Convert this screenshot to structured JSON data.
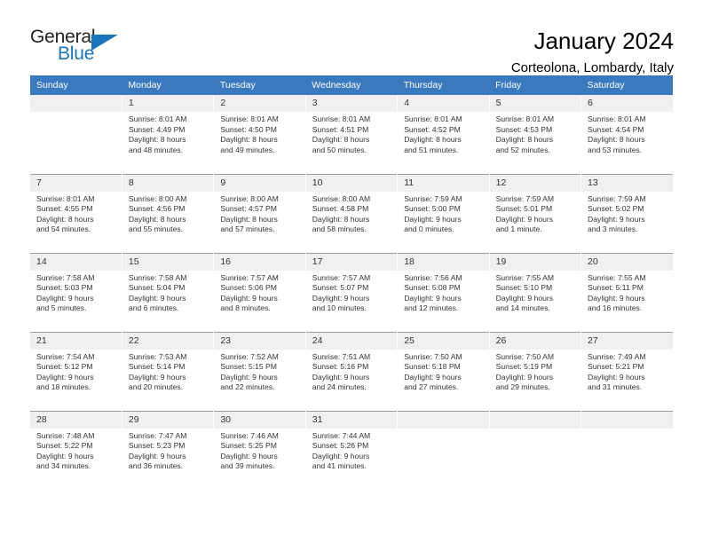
{
  "brand": {
    "word_one": "General",
    "word_two": "Blue",
    "triangle_color": "#1b75bb"
  },
  "header": {
    "title": "January 2024",
    "subtitle": "Corteolona, Lombardy, Italy"
  },
  "theme": {
    "header_row_bg": "#3b79bf",
    "header_row_text": "#ffffff",
    "daynum_bg": "#f0f0f0",
    "grid_line": "#9c9c9c",
    "body_text": "#333333"
  },
  "weekdays": [
    "Sunday",
    "Monday",
    "Tuesday",
    "Wednesday",
    "Thursday",
    "Friday",
    "Saturday"
  ],
  "labels": {
    "sunrise_prefix": "Sunrise:",
    "sunset_prefix": "Sunset:",
    "daylight_prefix": "Daylight:"
  },
  "weeks": [
    [
      {
        "empty": true
      },
      {
        "day": "1",
        "sunrise": "Sunrise: 8:01 AM",
        "sunset": "Sunset: 4:49 PM",
        "daylight1": "Daylight: 8 hours",
        "daylight2": "and 48 minutes."
      },
      {
        "day": "2",
        "sunrise": "Sunrise: 8:01 AM",
        "sunset": "Sunset: 4:50 PM",
        "daylight1": "Daylight: 8 hours",
        "daylight2": "and 49 minutes."
      },
      {
        "day": "3",
        "sunrise": "Sunrise: 8:01 AM",
        "sunset": "Sunset: 4:51 PM",
        "daylight1": "Daylight: 8 hours",
        "daylight2": "and 50 minutes."
      },
      {
        "day": "4",
        "sunrise": "Sunrise: 8:01 AM",
        "sunset": "Sunset: 4:52 PM",
        "daylight1": "Daylight: 8 hours",
        "daylight2": "and 51 minutes."
      },
      {
        "day": "5",
        "sunrise": "Sunrise: 8:01 AM",
        "sunset": "Sunset: 4:53 PM",
        "daylight1": "Daylight: 8 hours",
        "daylight2": "and 52 minutes."
      },
      {
        "day": "6",
        "sunrise": "Sunrise: 8:01 AM",
        "sunset": "Sunset: 4:54 PM",
        "daylight1": "Daylight: 8 hours",
        "daylight2": "and 53 minutes."
      }
    ],
    [
      {
        "day": "7",
        "sunrise": "Sunrise: 8:01 AM",
        "sunset": "Sunset: 4:55 PM",
        "daylight1": "Daylight: 8 hours",
        "daylight2": "and 54 minutes."
      },
      {
        "day": "8",
        "sunrise": "Sunrise: 8:00 AM",
        "sunset": "Sunset: 4:56 PM",
        "daylight1": "Daylight: 8 hours",
        "daylight2": "and 55 minutes."
      },
      {
        "day": "9",
        "sunrise": "Sunrise: 8:00 AM",
        "sunset": "Sunset: 4:57 PM",
        "daylight1": "Daylight: 8 hours",
        "daylight2": "and 57 minutes."
      },
      {
        "day": "10",
        "sunrise": "Sunrise: 8:00 AM",
        "sunset": "Sunset: 4:58 PM",
        "daylight1": "Daylight: 8 hours",
        "daylight2": "and 58 minutes."
      },
      {
        "day": "11",
        "sunrise": "Sunrise: 7:59 AM",
        "sunset": "Sunset: 5:00 PM",
        "daylight1": "Daylight: 9 hours",
        "daylight2": "and 0 minutes."
      },
      {
        "day": "12",
        "sunrise": "Sunrise: 7:59 AM",
        "sunset": "Sunset: 5:01 PM",
        "daylight1": "Daylight: 9 hours",
        "daylight2": "and 1 minute."
      },
      {
        "day": "13",
        "sunrise": "Sunrise: 7:59 AM",
        "sunset": "Sunset: 5:02 PM",
        "daylight1": "Daylight: 9 hours",
        "daylight2": "and 3 minutes."
      }
    ],
    [
      {
        "day": "14",
        "sunrise": "Sunrise: 7:58 AM",
        "sunset": "Sunset: 5:03 PM",
        "daylight1": "Daylight: 9 hours",
        "daylight2": "and 5 minutes."
      },
      {
        "day": "15",
        "sunrise": "Sunrise: 7:58 AM",
        "sunset": "Sunset: 5:04 PM",
        "daylight1": "Daylight: 9 hours",
        "daylight2": "and 6 minutes."
      },
      {
        "day": "16",
        "sunrise": "Sunrise: 7:57 AM",
        "sunset": "Sunset: 5:06 PM",
        "daylight1": "Daylight: 9 hours",
        "daylight2": "and 8 minutes."
      },
      {
        "day": "17",
        "sunrise": "Sunrise: 7:57 AM",
        "sunset": "Sunset: 5:07 PM",
        "daylight1": "Daylight: 9 hours",
        "daylight2": "and 10 minutes."
      },
      {
        "day": "18",
        "sunrise": "Sunrise: 7:56 AM",
        "sunset": "Sunset: 5:08 PM",
        "daylight1": "Daylight: 9 hours",
        "daylight2": "and 12 minutes."
      },
      {
        "day": "19",
        "sunrise": "Sunrise: 7:55 AM",
        "sunset": "Sunset: 5:10 PM",
        "daylight1": "Daylight: 9 hours",
        "daylight2": "and 14 minutes."
      },
      {
        "day": "20",
        "sunrise": "Sunrise: 7:55 AM",
        "sunset": "Sunset: 5:11 PM",
        "daylight1": "Daylight: 9 hours",
        "daylight2": "and 16 minutes."
      }
    ],
    [
      {
        "day": "21",
        "sunrise": "Sunrise: 7:54 AM",
        "sunset": "Sunset: 5:12 PM",
        "daylight1": "Daylight: 9 hours",
        "daylight2": "and 18 minutes."
      },
      {
        "day": "22",
        "sunrise": "Sunrise: 7:53 AM",
        "sunset": "Sunset: 5:14 PM",
        "daylight1": "Daylight: 9 hours",
        "daylight2": "and 20 minutes."
      },
      {
        "day": "23",
        "sunrise": "Sunrise: 7:52 AM",
        "sunset": "Sunset: 5:15 PM",
        "daylight1": "Daylight: 9 hours",
        "daylight2": "and 22 minutes."
      },
      {
        "day": "24",
        "sunrise": "Sunrise: 7:51 AM",
        "sunset": "Sunset: 5:16 PM",
        "daylight1": "Daylight: 9 hours",
        "daylight2": "and 24 minutes."
      },
      {
        "day": "25",
        "sunrise": "Sunrise: 7:50 AM",
        "sunset": "Sunset: 5:18 PM",
        "daylight1": "Daylight: 9 hours",
        "daylight2": "and 27 minutes."
      },
      {
        "day": "26",
        "sunrise": "Sunrise: 7:50 AM",
        "sunset": "Sunset: 5:19 PM",
        "daylight1": "Daylight: 9 hours",
        "daylight2": "and 29 minutes."
      },
      {
        "day": "27",
        "sunrise": "Sunrise: 7:49 AM",
        "sunset": "Sunset: 5:21 PM",
        "daylight1": "Daylight: 9 hours",
        "daylight2": "and 31 minutes."
      }
    ],
    [
      {
        "day": "28",
        "sunrise": "Sunrise: 7:48 AM",
        "sunset": "Sunset: 5:22 PM",
        "daylight1": "Daylight: 9 hours",
        "daylight2": "and 34 minutes."
      },
      {
        "day": "29",
        "sunrise": "Sunrise: 7:47 AM",
        "sunset": "Sunset: 5:23 PM",
        "daylight1": "Daylight: 9 hours",
        "daylight2": "and 36 minutes."
      },
      {
        "day": "30",
        "sunrise": "Sunrise: 7:46 AM",
        "sunset": "Sunset: 5:25 PM",
        "daylight1": "Daylight: 9 hours",
        "daylight2": "and 39 minutes."
      },
      {
        "day": "31",
        "sunrise": "Sunrise: 7:44 AM",
        "sunset": "Sunset: 5:26 PM",
        "daylight1": "Daylight: 9 hours",
        "daylight2": "and 41 minutes."
      },
      {
        "empty": true
      },
      {
        "empty": true
      },
      {
        "empty": true
      }
    ]
  ]
}
